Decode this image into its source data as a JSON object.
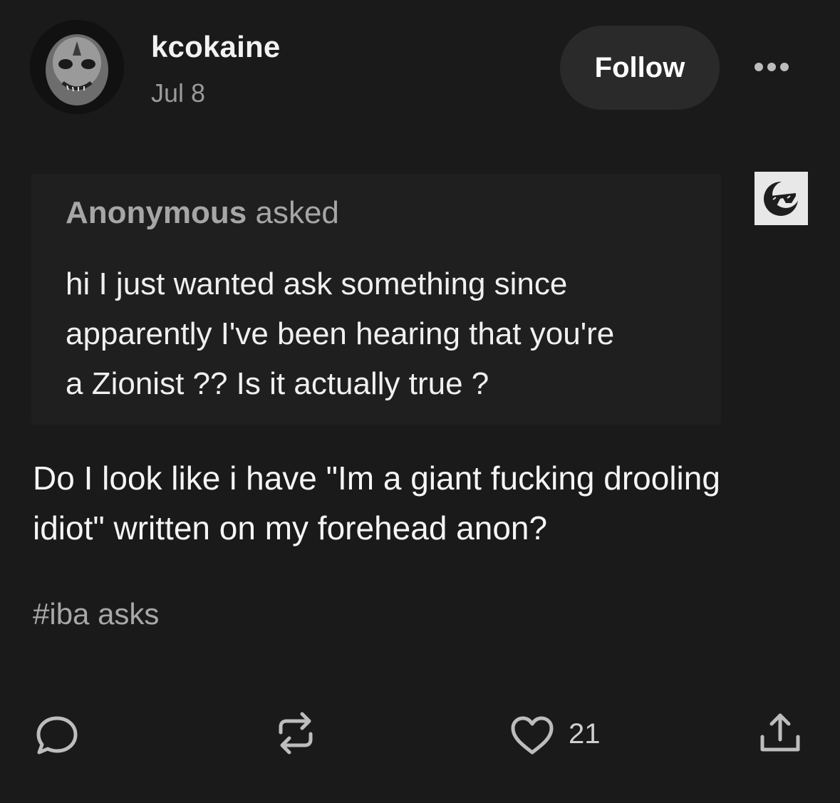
{
  "header": {
    "username": "kcokaine",
    "date": "Jul 8",
    "follow_label": "Follow"
  },
  "ask": {
    "asker": "Anonymous",
    "asked_label": "asked",
    "lines": [
      "hi I just wanted ask something since",
      "apparently I've been hearing that you're",
      "a Zionist ?? Is it actually true ?"
    ]
  },
  "answer": {
    "lines": [
      "Do I look like i have \"Im a giant fucking drooling",
      "idiot\" written on my forehead anon?"
    ]
  },
  "tags": [
    "#iba asks"
  ],
  "footer": {
    "like_count": "21"
  },
  "icons": {
    "reply": "reply-bubble-icon",
    "reblog": "reblog-icon",
    "like": "heart-icon",
    "share": "share-icon",
    "more": "ellipsis-icon"
  },
  "colors": {
    "background": "#1a1a1a",
    "ask_box": "#1f1f1f",
    "follow_button": "#2a2a2a",
    "muted_text": "#9a9a9a"
  }
}
